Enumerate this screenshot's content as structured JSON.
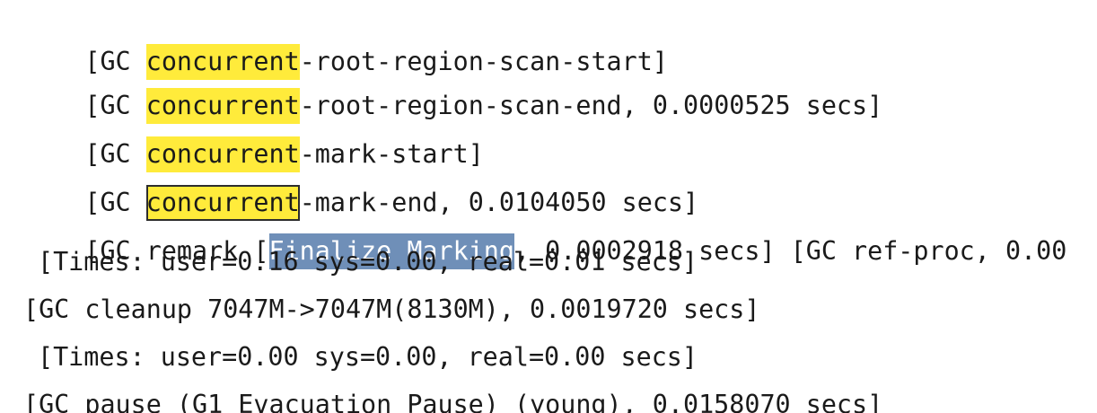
{
  "log": {
    "lines": [
      {
        "pre": "[GC ",
        "match": "concurrent",
        "post": "-root-region-scan-start]"
      },
      {
        "pre": "[GC ",
        "match": "concurrent",
        "post": "-root-region-scan-end, 0.0000525 secs]"
      },
      {
        "pre": "[GC ",
        "match": "concurrent",
        "post": "-mark-start]"
      },
      {
        "pre": "[GC ",
        "match": "concurrent",
        "post": "-mark-end, 0.0104050 secs]"
      },
      {
        "pre": "[GC remark [",
        "selected": "Finalize Marking",
        "post": ", 0.0002918 secs] [GC ref-proc, 0.00"
      },
      {
        "text": "[Times: user=0.16 sys=0.00, real=0.01 secs]"
      },
      {
        "text": "[GC cleanup 7047M->7047M(8130M), 0.0019720 secs]"
      },
      {
        "text": "[Times: user=0.00 sys=0.00, real=0.00 secs]"
      },
      {
        "text": "[GC pause (G1 Evacuation Pause) (young), 0.0158070 secs]"
      }
    ]
  },
  "search": {
    "term": "concurrent",
    "highlight_color": "#ffeb3b",
    "selection_color": "#6f8fb8"
  }
}
